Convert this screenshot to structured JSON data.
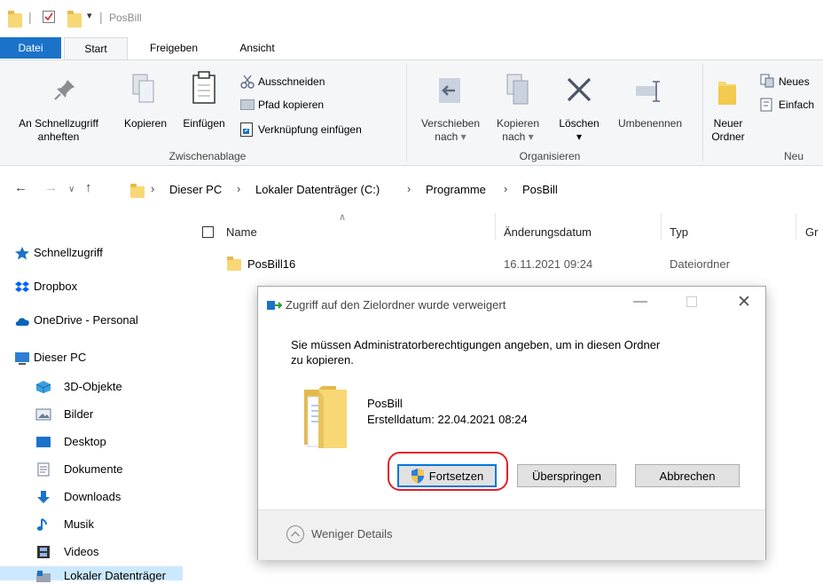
{
  "window": {
    "title": "PosBill"
  },
  "ribbon_tabs": [
    "Datei",
    "Start",
    "Freigeben",
    "Ansicht"
  ],
  "ribbon": {
    "zwischenablage": {
      "pin_line1": "An Schnellzugriff",
      "pin_line2": "anheften",
      "copy": "Kopieren",
      "paste": "Einfügen",
      "cut": "Ausschneiden",
      "copy_path": "Pfad kopieren",
      "paste_shortcut": "Verknüpfung einfügen",
      "group": "Zwischenablage"
    },
    "organisieren": {
      "move_line1": "Verschieben",
      "move_line2": "nach",
      "copy_line1": "Kopieren",
      "copy_line2": "nach",
      "delete": "Löschen",
      "rename": "Umbenennen",
      "group": "Organisieren"
    },
    "neu": {
      "new_folder_line1": "Neuer",
      "new_folder_line2": "Ordner",
      "new_item": "Neues",
      "easy_access": "Einfach",
      "group": "Neu"
    }
  },
  "address_bar": {
    "crumbs": [
      "Dieser PC",
      "Lokaler Datenträger (C:)",
      "Programme",
      "PosBill"
    ]
  },
  "navigation": {
    "items": [
      "Schnellzugriff",
      "Dropbox",
      "OneDrive - Personal",
      "Dieser PC",
      "3D-Objekte",
      "Bilder",
      "Desktop",
      "Dokumente",
      "Downloads",
      "Musik",
      "Videos",
      "Lokaler Datenträger"
    ]
  },
  "file_list": {
    "columns": [
      "Name",
      "Änderungsdatum",
      "Typ",
      "Gr"
    ],
    "rows": [
      {
        "name": "PosBill16",
        "date": "16.11.2021 09:24",
        "type": "Dateiordner"
      }
    ]
  },
  "dialog": {
    "title": "Zugriff auf den Zielordner wurde verweigert",
    "message_line1": "Sie müssen Administratorberechtigungen angeben, um in diesen Ordner",
    "message_line2": "zu kopieren.",
    "item_name": "PosBill",
    "item_date": "Erstelldatum: 22.04.2021 08:24",
    "continue": "Fortsetzen",
    "skip": "Überspringen",
    "cancel": "Abbrechen",
    "details_toggle": "Weniger Details"
  },
  "colors": {
    "accent": "#1a73c8",
    "highlight_circle": "#e0202a",
    "folder": "#f8d775"
  }
}
